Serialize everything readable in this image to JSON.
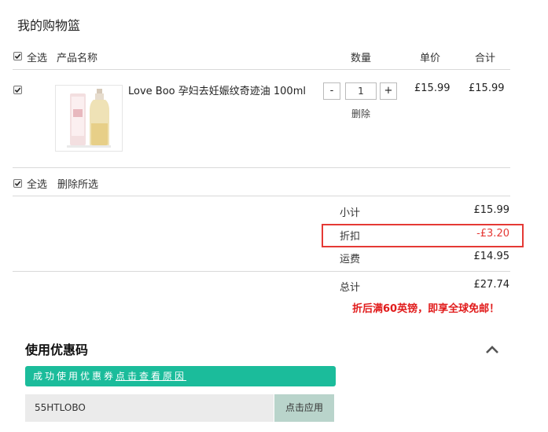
{
  "page": {
    "title": "我的购物篮"
  },
  "header": {
    "select_all": "全选",
    "product_name": "产品名称",
    "quantity": "数量",
    "unit_price": "单价",
    "total": "合计"
  },
  "cart": {
    "items": [
      {
        "checked": true,
        "name": "Love Boo 孕妇去妊娠纹奇迹油 100ml",
        "quantity": "1",
        "minus": "-",
        "plus": "+",
        "delete": "删除",
        "unit_price": "£15.99",
        "line_total": "£15.99"
      }
    ]
  },
  "footer_actions": {
    "select_all": "全选",
    "delete_selected": "删除所选"
  },
  "summary": {
    "subtotal_label": "小计",
    "subtotal_value": "£15.99",
    "discount_label": "折扣",
    "discount_value": "-£3.20",
    "shipping_label": "运费",
    "shipping_value": "£14.95",
    "total_label": "总计",
    "total_value": "£27.74",
    "promo": "折后满60英镑，即享全球免邮！"
  },
  "coupon": {
    "title": "使用优惠码",
    "banner_prefix": "成功使用优惠券",
    "banner_link": "点击查看原因",
    "code_value": "55HTLOBO",
    "apply_label": "点击应用"
  },
  "colors": {
    "accent_green": "#1bbc9b",
    "discount_red": "#e53935",
    "promo_red": "#e11b1b",
    "apply_bg": "#b9d4cb"
  }
}
